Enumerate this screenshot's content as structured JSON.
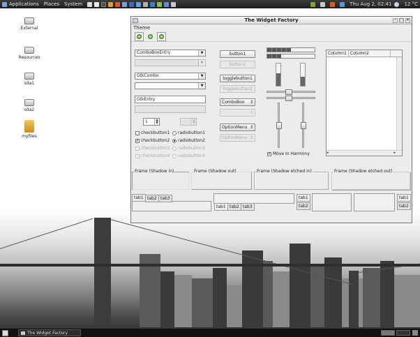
{
  "top_panel": {
    "menus": [
      "Applications",
      "Places",
      "System"
    ],
    "datetime": "Thu Aug  2, 02:41",
    "temperature": "12 °C"
  },
  "desktop_icons": [
    {
      "label": "External",
      "type": "drive"
    },
    {
      "label": "Resources",
      "type": "drive"
    },
    {
      "label": "sda1",
      "type": "drive"
    },
    {
      "label": "sda2",
      "type": "drive"
    },
    {
      "label": "myfiles",
      "type": "folder"
    }
  ],
  "window": {
    "title": "The Widget Factory",
    "menu": [
      "Theme"
    ],
    "combos": {
      "combo1": "ComboBoxEntry",
      "combo2": "",
      "combo3": "GtkCombo",
      "combo4": ""
    },
    "entries": {
      "entry1": "GtkEntry",
      "entry2": ""
    },
    "spin1": "1",
    "spin2": "",
    "checkbuttons": [
      "checkbutton1",
      "checkbutton2",
      "checkbutton3",
      "checkbutton4"
    ],
    "radiobuttons": [
      "radiobutton1",
      "radiobutton2",
      "radiobutton3",
      "radiobutton4"
    ],
    "buttons": {
      "button1": "button1",
      "button2": "button2",
      "toggle1": "togglebutton1",
      "toggle2": "togglebutton2",
      "combobox": "ComboBox",
      "optionmenu": "OptionMenu"
    },
    "move_in_harmony": "Move In Harmony",
    "progress": {
      "h1": 0.5,
      "h2": 0.3,
      "v1": 0.55,
      "v2": 0.4
    },
    "sliders": {
      "h1": 0.45,
      "h2": 0.45,
      "v1": 0.5,
      "v2": 0.5
    },
    "treeview": {
      "columns": [
        "Column1",
        "Column2"
      ]
    },
    "frames": [
      "Frame (Shadow in)",
      "Frame (Shadow out)",
      "Frame (Shadow etched in)",
      "Frame (Shadow etched out)"
    ],
    "tabs": [
      "tab1",
      "tab2",
      "tab3"
    ]
  },
  "taskbar": {
    "task": "The Widget Factory"
  }
}
